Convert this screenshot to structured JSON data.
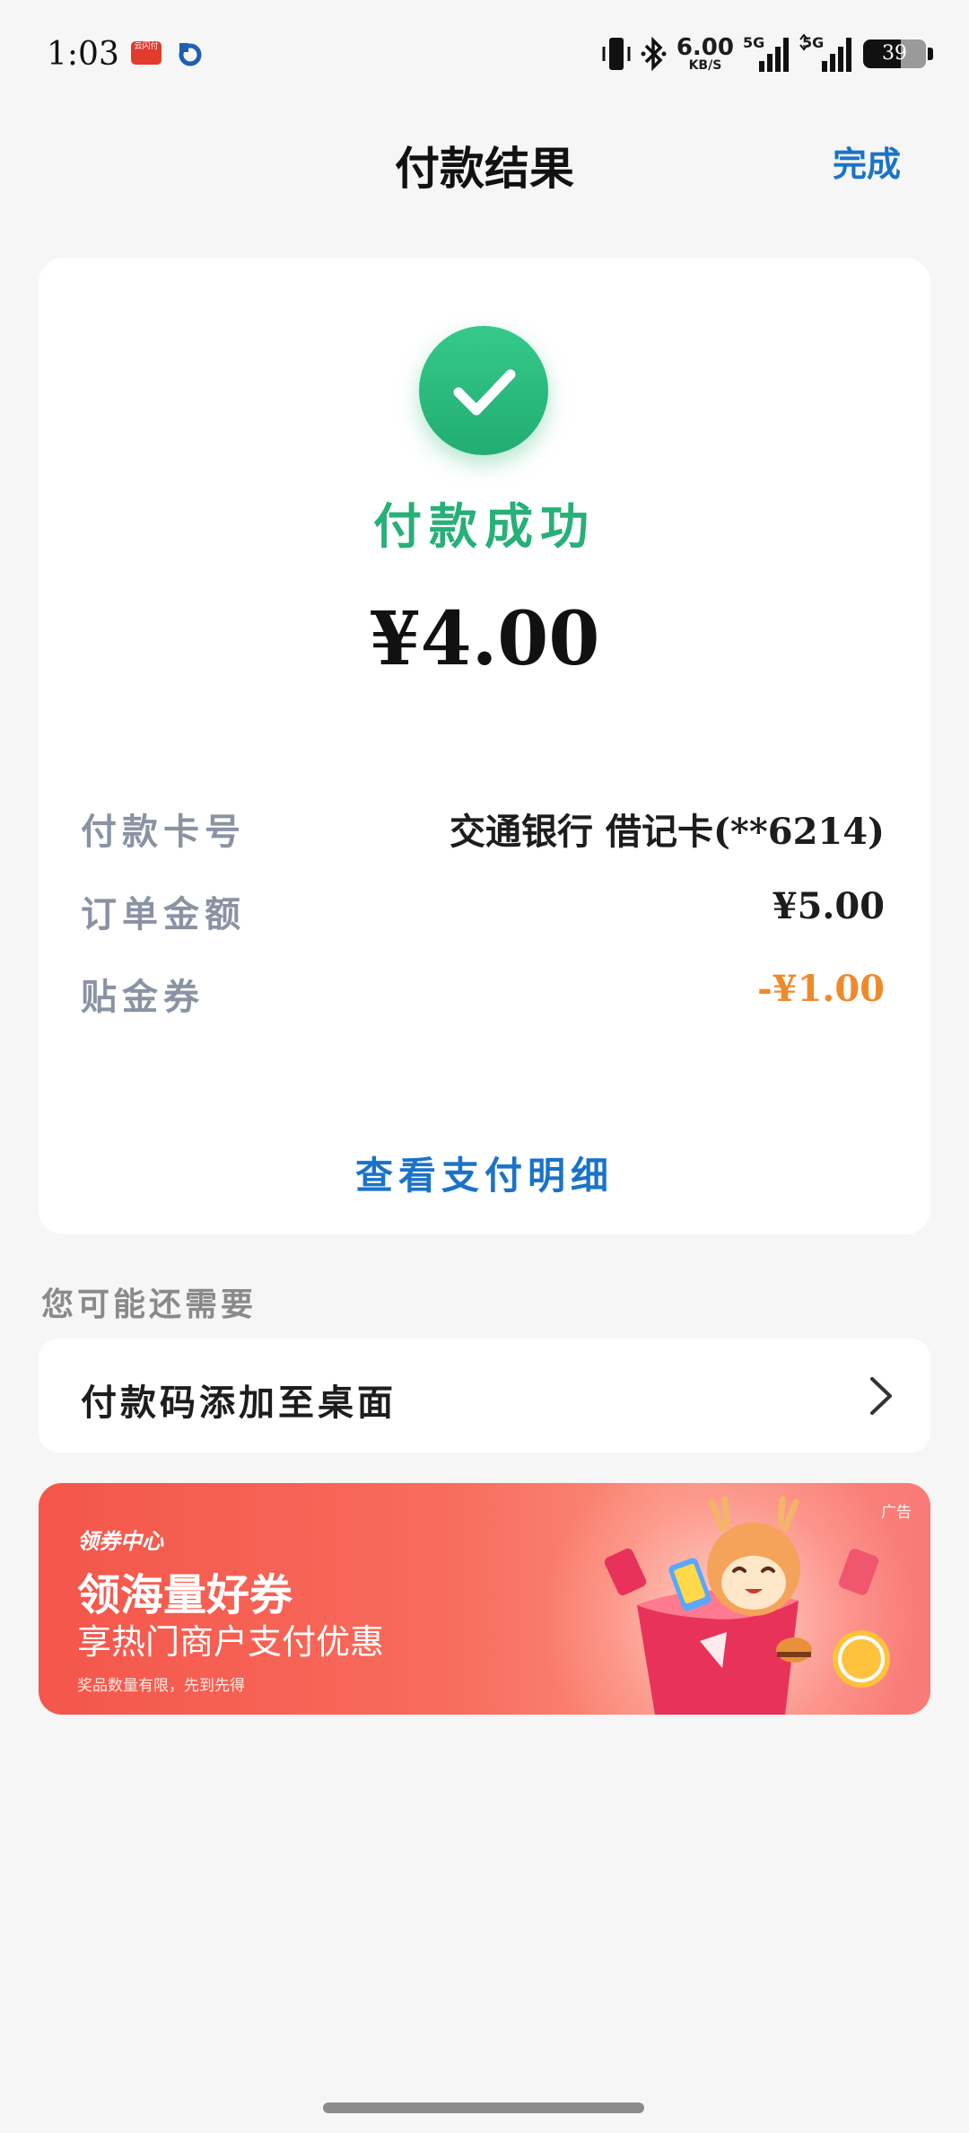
{
  "status_bar": {
    "time": "1:03",
    "app_badge": "云闪付",
    "net_speed": "6.00",
    "net_unit": "KB/S",
    "signal1": "5G",
    "signal2": "5G",
    "battery": "39"
  },
  "header": {
    "title": "付款结果",
    "done_label": "完成"
  },
  "result": {
    "status_text": "付款成功",
    "amount": "¥4.00",
    "rows": [
      {
        "label": "付款卡号",
        "value": "交通银行 借记卡(**6214)"
      },
      {
        "label": "订单金额",
        "value": "¥5.00"
      },
      {
        "label": "贴金券",
        "value": "-¥1.00"
      }
    ],
    "detail_link": "查看支付明细"
  },
  "suggest": {
    "section_title": "您可能还需要",
    "shortcut_label": "付款码添加至桌面"
  },
  "banner": {
    "ad_tag": "广告",
    "brand": "领券中心",
    "headline": "领海量好券",
    "subline": "享热门商户支付优惠",
    "note": "奖品数量有限，先到先得"
  },
  "colors": {
    "accent_blue": "#1a73c8",
    "success_green": "#27b077",
    "discount_orange": "#ef8a2c",
    "banner_red": "#f4564b"
  }
}
